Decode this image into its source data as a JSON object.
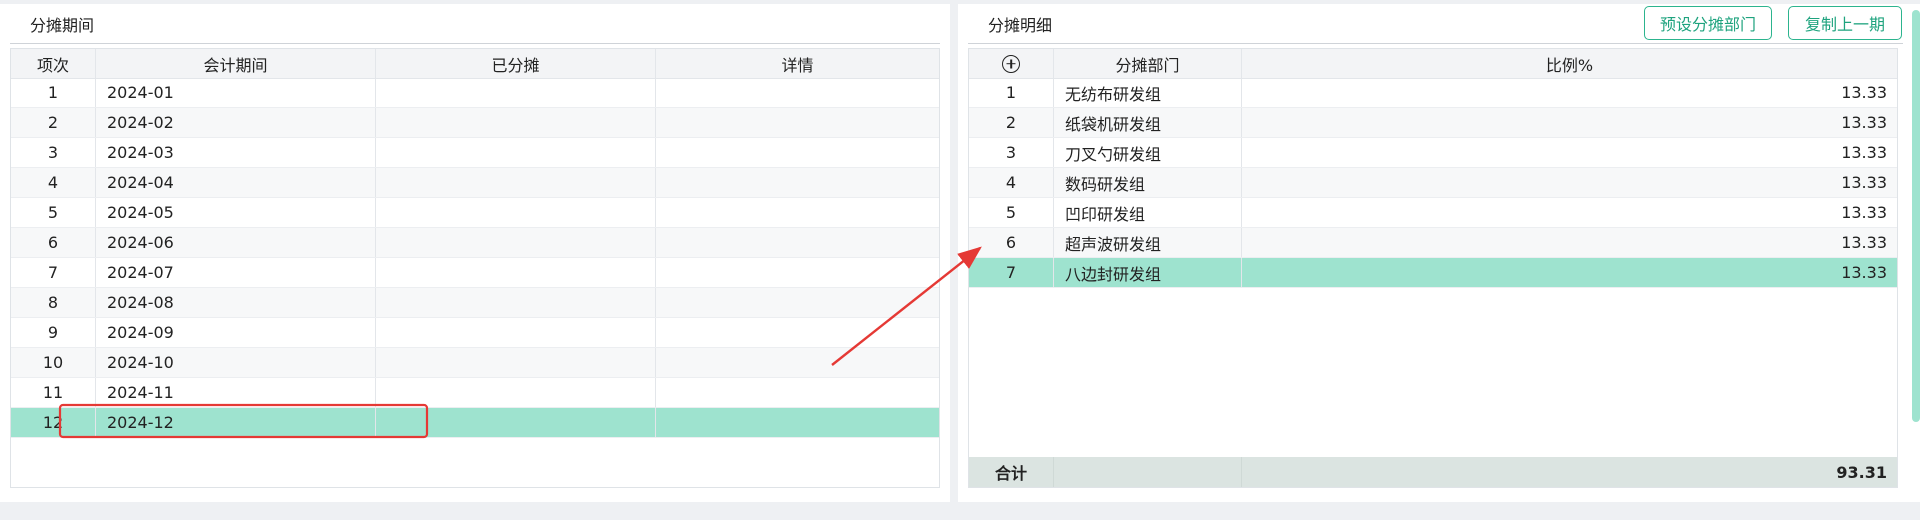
{
  "left": {
    "title": "分摊期间",
    "columns": [
      "项次",
      "会计期间",
      "已分摊",
      "详情"
    ],
    "rows": [
      {
        "index": "1",
        "period": "2024-01",
        "allocated": "",
        "detail": ""
      },
      {
        "index": "2",
        "period": "2024-02",
        "allocated": "",
        "detail": ""
      },
      {
        "index": "3",
        "period": "2024-03",
        "allocated": "",
        "detail": ""
      },
      {
        "index": "4",
        "period": "2024-04",
        "allocated": "",
        "detail": ""
      },
      {
        "index": "5",
        "period": "2024-05",
        "allocated": "",
        "detail": ""
      },
      {
        "index": "6",
        "period": "2024-06",
        "allocated": "",
        "detail": ""
      },
      {
        "index": "7",
        "period": "2024-07",
        "allocated": "",
        "detail": ""
      },
      {
        "index": "8",
        "period": "2024-08",
        "allocated": "",
        "detail": ""
      },
      {
        "index": "9",
        "period": "2024-09",
        "allocated": "",
        "detail": ""
      },
      {
        "index": "10",
        "period": "2024-10",
        "allocated": "",
        "detail": ""
      },
      {
        "index": "11",
        "period": "2024-11",
        "allocated": "",
        "detail": ""
      },
      {
        "index": "12",
        "period": "2024-12",
        "allocated": "",
        "detail": ""
      }
    ],
    "selected_row": 12
  },
  "right": {
    "title": "分摊明细",
    "preset_button": "预设分摊部门",
    "copy_button": "复制上一期",
    "add_icon": "plus-circle-icon",
    "columns": [
      "分摊部门",
      "比例%"
    ],
    "rows": [
      {
        "index": "1",
        "dept": "无纺布研发组",
        "ratio": "13.33"
      },
      {
        "index": "2",
        "dept": "纸袋机研发组",
        "ratio": "13.33"
      },
      {
        "index": "3",
        "dept": "刀叉勺研发组",
        "ratio": "13.33"
      },
      {
        "index": "4",
        "dept": "数码研发组",
        "ratio": "13.33"
      },
      {
        "index": "5",
        "dept": "凹印研发组",
        "ratio": "13.33"
      },
      {
        "index": "6",
        "dept": "超声波研发组",
        "ratio": "13.33"
      },
      {
        "index": "7",
        "dept": "八边封研发组",
        "ratio": "13.33"
      }
    ],
    "selected_row": 7,
    "footer_label": "合计",
    "footer_total": "93.31"
  },
  "colors": {
    "selected_row": "#9ee3cf",
    "accent": "#1ea37e",
    "annotation": "#e53935"
  }
}
